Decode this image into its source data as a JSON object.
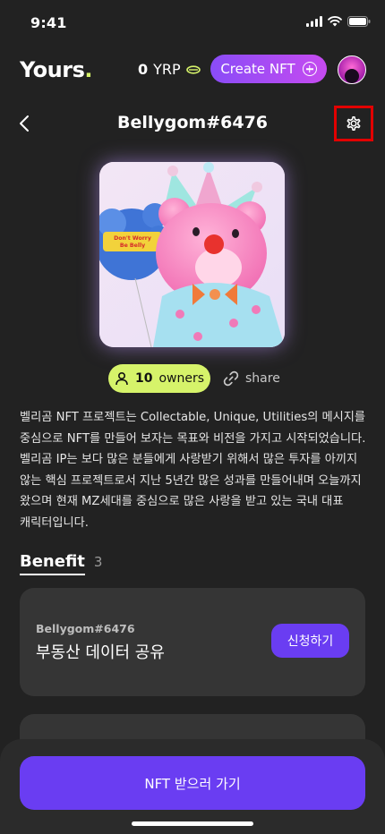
{
  "status": {
    "time": "9:41"
  },
  "header": {
    "logo_text": "Yours",
    "logo_dot": ".",
    "balance_value": "0",
    "balance_unit": "YRP",
    "create_label": "Create NFT"
  },
  "nft": {
    "title": "Bellygom#6476",
    "owners_count": "10",
    "owners_label": "owners",
    "share_label": "share",
    "description": "벨리곰 NFT 프로젝트는 Collectable, Unique, Utilities의 메시지를 중심으로 NFT를 만들어 보자는 목표와 비전을 가지고 시작되었습니다. 벨리곰 IP는 보다 많은 분들에게 사랑받기 위해서 많은 투자를 아끼지 않는 핵심 프로젝트로서 지난 5년간 많은 성과를 만들어내며 오늘까지 왔으며 현재 MZ세대를 중심으로 많은 사랑을 받고 있는 국내 대표 캐릭터입니다.",
    "image_text": "Don't Worry Be Belly"
  },
  "benefit": {
    "title": "Benefit",
    "count": "3",
    "items": [
      {
        "subtitle": "Bellygom#6476",
        "title": "부동산 데이터 공유",
        "action": "신청하기"
      }
    ]
  },
  "cta": {
    "label": "NFT 받으러 가기"
  },
  "colors": {
    "background": "#222222",
    "card": "#353535",
    "accent": "#6a3df2",
    "lime": "#d6f36a"
  }
}
